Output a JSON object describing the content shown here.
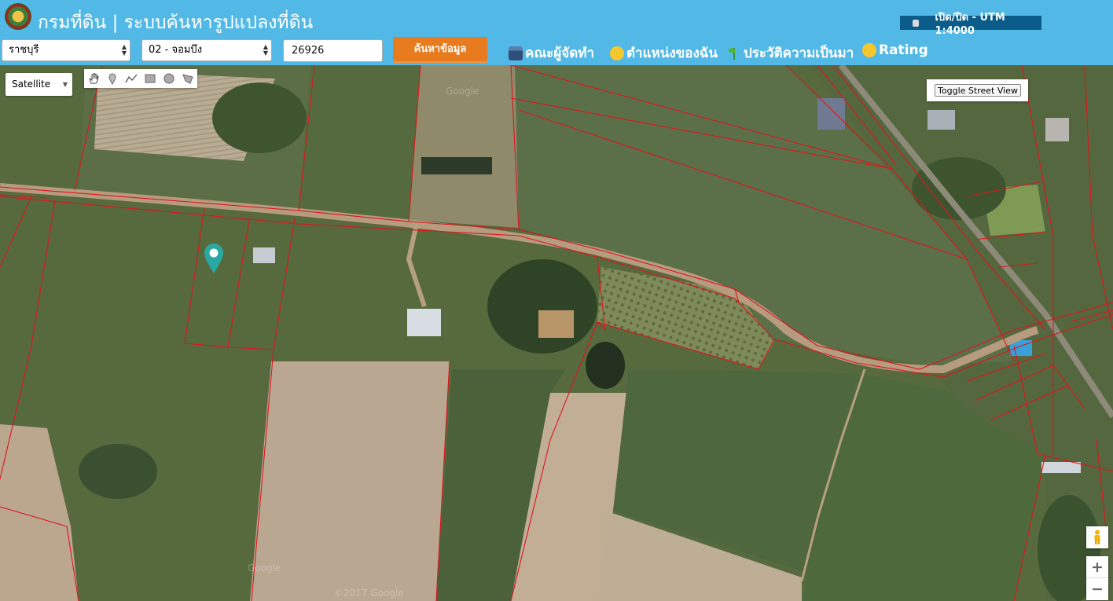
{
  "header": {
    "title": "กรมที่ดิน | ระบบค้นหารูปแปลงที่ดิน",
    "utm_toggle_label": "เปิด/ปิด - UTM 1:4000"
  },
  "search": {
    "province": "ราชบุรี",
    "district": "02 - จอมบึง",
    "parcel_number": "26926",
    "search_button": "ค้นหาข้อมูล"
  },
  "nav": {
    "team": "คณะผู้จัดทำ",
    "my_location": "ตำแหน่งของฉัน",
    "history": "ประวัติความเป็นมา",
    "rating": "Rating"
  },
  "map": {
    "map_type": "Satellite",
    "toggle_street_view": "Toggle Street View",
    "zoom_in": "+",
    "zoom_out": "−",
    "watermark_top": "Google",
    "watermark_bottom": "©2017 Google",
    "watermark_mid": "Google",
    "drawing_tools": [
      "hand-icon",
      "marker-icon",
      "polyline-icon",
      "rectangle-icon",
      "circle-icon",
      "polygon-icon"
    ],
    "colors": {
      "header_bg": "#52b9e6",
      "search_button": "#e87b1e",
      "utm_toggle": "#0b5c8a",
      "parcel_boundary": "#e0141e",
      "marker": "#2aa9a4"
    }
  }
}
